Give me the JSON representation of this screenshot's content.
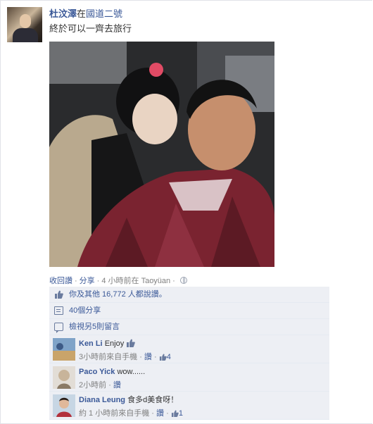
{
  "post": {
    "author": "杜汶澤",
    "at_word": "在",
    "location": "國道二號",
    "message": "終於可以一齊去旅行",
    "actions": {
      "unsave": "收回讚",
      "share": "分享",
      "time": "4 小時前在 Taoyüan",
      "separator": "·"
    },
    "likes_text": "你及其他 16,772 人都說讚。",
    "shares_text": "40個分享",
    "view_more_comments": "檢視另5則留言"
  },
  "comments": [
    {
      "name": "Ken Li",
      "text": "Enjoy",
      "time": "3小時前來自手機",
      "like_label": "讚",
      "like_count": "4"
    },
    {
      "name": "Paco Yick",
      "text": "wow......",
      "time": "2小時前",
      "like_label": "讚",
      "like_count": ""
    },
    {
      "name": "Diana Leung",
      "text": "食多d美食呀！",
      "time": "約 1 小時前來自手機",
      "like_label": "讚",
      "like_count": "1"
    }
  ],
  "colors": {
    "link": "#3b5998",
    "ufi_bg": "#edeff4",
    "meta_gray": "#808080"
  },
  "icons": [
    "like-icon",
    "share-icon",
    "comment-icon",
    "globe-icon"
  ]
}
